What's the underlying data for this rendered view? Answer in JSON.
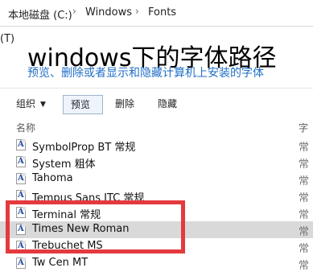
{
  "address": {
    "segments": [
      "本地磁盘 (C:)",
      "Windows",
      "Fonts"
    ],
    "separator": "›"
  },
  "menu_fragment": "(T)",
  "overlay": {
    "title": "windows下的字体路径",
    "subtitle": "预览、删除或者显示和隐藏计算机上安装的字体"
  },
  "toolbar": {
    "organize": "组织",
    "caret": "▼",
    "preview": "预览",
    "delete": "删除",
    "hide": "隐藏"
  },
  "columns": {
    "name": "名称",
    "right": "字"
  },
  "files": [
    {
      "name": "SymbolProp BT 常规",
      "right": "常",
      "icon": "font-file-icon"
    },
    {
      "name": "System 粗体",
      "right": "常",
      "icon": "font-file-icon"
    },
    {
      "name": "Tahoma",
      "right": "常",
      "icon": "font-file-icon"
    },
    {
      "name": "Tempus Sans ITC 常规",
      "right": "常",
      "icon": "font-file-icon"
    },
    {
      "name": "Terminal 常规",
      "right": "常",
      "icon": "font-file-icon"
    },
    {
      "name": "Times New Roman",
      "right": "常",
      "icon": "font-file-icon",
      "selected": true
    },
    {
      "name": "Trebuchet MS",
      "right": "常",
      "icon": "font-file-icon"
    },
    {
      "name": "Tw Cen MT",
      "right": "常",
      "icon": "font-file-icon"
    }
  ],
  "colors": {
    "highlight": "#e43a3e",
    "subtitle": "#1f6fc7",
    "selected_row": "#d9d9d9"
  }
}
